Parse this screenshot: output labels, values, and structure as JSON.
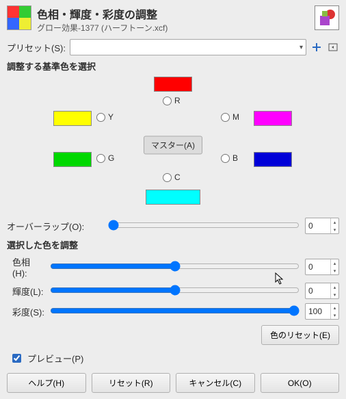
{
  "header": {
    "title": "色相・輝度・彩度の調整",
    "subtitle": "グロー効果-1377 (ハーフトーン.xcf)"
  },
  "preset": {
    "label": "プリセット(S):",
    "value": ""
  },
  "select_section": "調整する基準色を選択",
  "colors": {
    "r": "R",
    "y": "Y",
    "g": "G",
    "c": "C",
    "b": "B",
    "m": "M",
    "master": "マスター(A)",
    "swatches": {
      "r": "#ff0000",
      "y": "#ffff00",
      "g": "#00d800",
      "c": "#00ffff",
      "b": "#0000d8",
      "m": "#ff00ff"
    }
  },
  "overlap": {
    "label": "オーバーラップ(O):",
    "value": "0"
  },
  "adjust_section": "選択した色を調整",
  "sliders": {
    "hue": {
      "label": "色相(H):",
      "value": "0"
    },
    "light": {
      "label": "輝度(L):",
      "value": "0"
    },
    "sat": {
      "label": "彩度(S):",
      "value": "100"
    }
  },
  "reset_color": "色のリセット(E)",
  "preview": "プレビュー(P)",
  "buttons": {
    "help": "ヘルプ(H)",
    "reset": "リセット(R)",
    "cancel": "キャンセル(C)",
    "ok": "OK(O)"
  }
}
